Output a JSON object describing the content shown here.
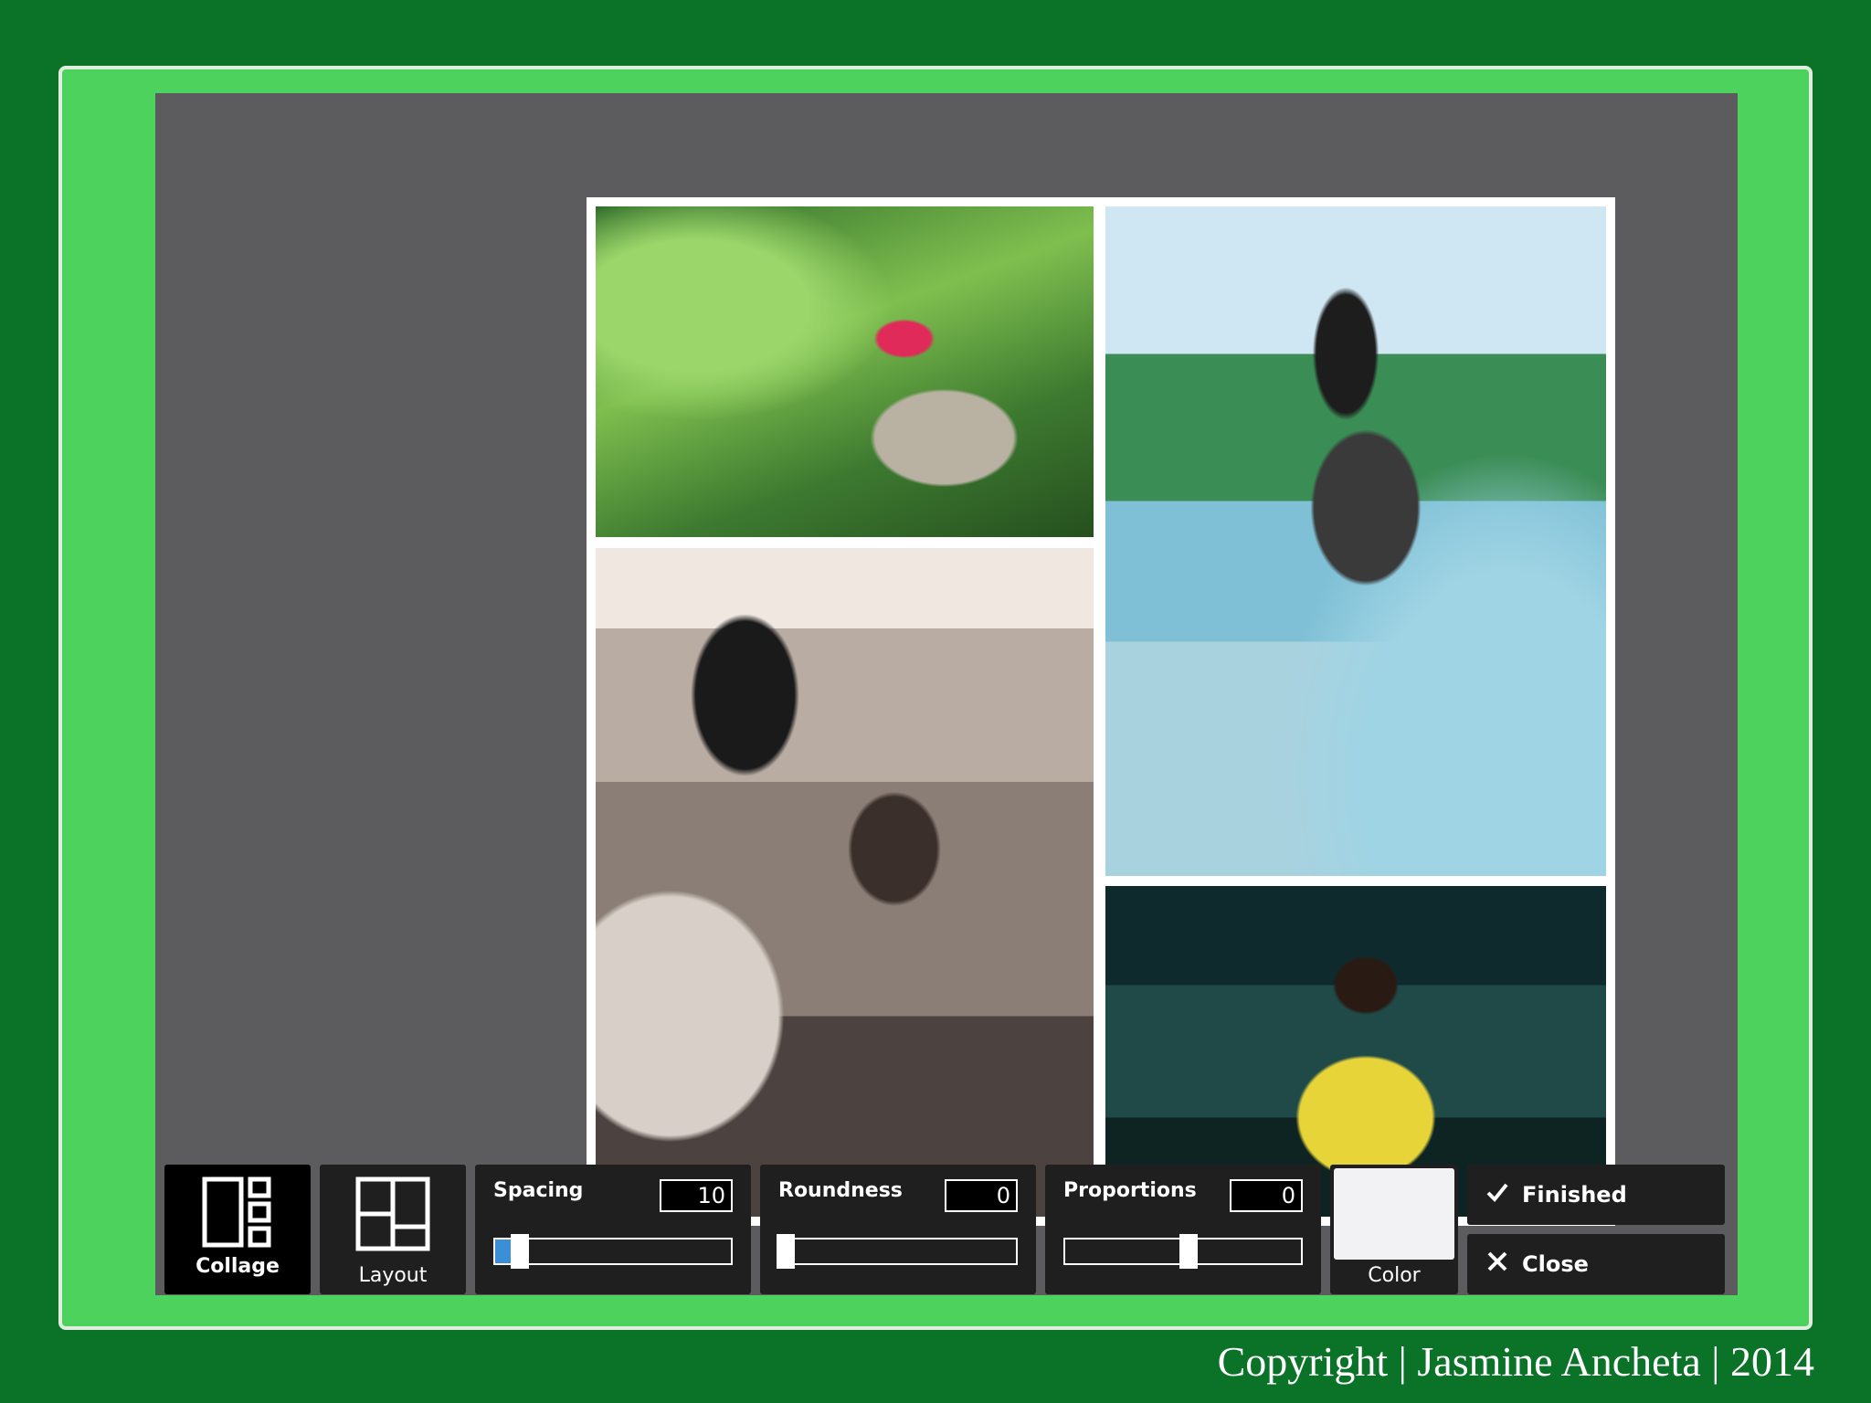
{
  "toolbar": {
    "collage_label": "Collage",
    "layout_label": "Layout",
    "spacing": {
      "label": "Spacing",
      "value": "10",
      "level": 0.08
    },
    "roundness": {
      "label": "Roundness",
      "value": "0",
      "level": 0.0
    },
    "proportions": {
      "label": "Proportions",
      "value": "0",
      "level": 0.5
    },
    "color_label": "Color",
    "color_value": "#f2f2f4",
    "finished_label": "Finished",
    "close_label": "Close"
  },
  "icons": {
    "collage": "collage-layout-icon",
    "layout": "grid-layout-icon",
    "finished": "check-icon",
    "close": "x-icon"
  },
  "colors": {
    "background": "#0a7328",
    "frame": "#4ed25e",
    "workspace": "#5c5b5e",
    "slider_fill": "#3a8fd6"
  },
  "footer": {
    "copyright": "Copyright | Jasmine Ancheta | 2014"
  }
}
